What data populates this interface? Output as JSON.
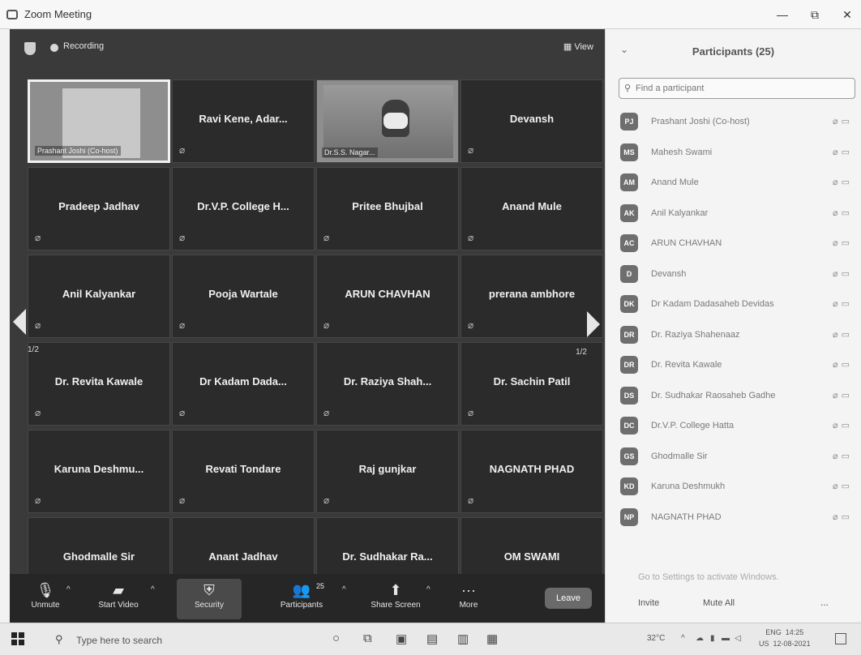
{
  "window": {
    "title": "Zoom Meeting",
    "controls": [
      "—",
      "⧉",
      "✕"
    ]
  },
  "meeting": {
    "recording_label": "Recording",
    "view_label": "View",
    "page_left": "1/2",
    "page_right": "1/2"
  },
  "tiles": [
    {
      "name": "Prashant Joshi (Co-host)",
      "type": "self"
    },
    {
      "name": "Ravi Kene, Adar...",
      "type": "name"
    },
    {
      "name": "Dr.S.S. Nagar...",
      "type": "video"
    },
    {
      "name": "Devansh",
      "type": "name"
    },
    {
      "name": "Pradeep Jadhav",
      "type": "name"
    },
    {
      "name": "Dr.V.P. College H...",
      "type": "name"
    },
    {
      "name": "Pritee Bhujbal",
      "type": "name"
    },
    {
      "name": "Anand Mule",
      "type": "name"
    },
    {
      "name": "Anil Kalyankar",
      "type": "name"
    },
    {
      "name": "Pooja Wartale",
      "type": "name"
    },
    {
      "name": "ARUN CHAVHAN",
      "type": "name"
    },
    {
      "name": "prerana ambhore",
      "type": "name"
    },
    {
      "name": "Dr. Revita Kawale",
      "type": "name"
    },
    {
      "name": "Dr Kadam Dada...",
      "type": "name"
    },
    {
      "name": "Dr. Raziya Shah...",
      "type": "name"
    },
    {
      "name": "Dr. Sachin Patil",
      "type": "name"
    },
    {
      "name": "Karuna Deshmu...",
      "type": "name"
    },
    {
      "name": "Revati Tondare",
      "type": "name"
    },
    {
      "name": "Raj gunjkar",
      "type": "name"
    },
    {
      "name": "NAGNATH PHAD",
      "type": "name"
    },
    {
      "name": "Ghodmalle Sir",
      "type": "name"
    },
    {
      "name": "Anant Jadhav",
      "type": "name"
    },
    {
      "name": "Dr. Sudhakar Ra...",
      "type": "name"
    },
    {
      "name": "OM SWAMI",
      "type": "name"
    }
  ],
  "toolbar": {
    "unmute": "Unmute",
    "start_video": "Start Video",
    "security": "Security",
    "participants": "Participants",
    "participants_count": "25",
    "share_screen": "Share Screen",
    "more": "More",
    "leave": "Leave"
  },
  "panel": {
    "title": "Participants (25)",
    "search_placeholder": "Find a participant",
    "participants": [
      {
        "initials": "PJ",
        "name": "Prashant Joshi (Co-host)"
      },
      {
        "initials": "MS",
        "name": "Mahesh Swami"
      },
      {
        "initials": "AM",
        "name": "Anand Mule"
      },
      {
        "initials": "AK",
        "name": "Anil Kalyankar"
      },
      {
        "initials": "AC",
        "name": "ARUN CHAVHAN"
      },
      {
        "initials": "D",
        "name": "Devansh"
      },
      {
        "initials": "DK",
        "name": "Dr Kadam Dadasaheb Devidas"
      },
      {
        "initials": "DR",
        "name": "Dr. Raziya Shahenaaz"
      },
      {
        "initials": "DR",
        "name": "Dr. Revita Kawale"
      },
      {
        "initials": "DS",
        "name": "Dr. Sudhakar Raosaheb Gadhe"
      },
      {
        "initials": "DC",
        "name": "Dr.V.P. College Hatta"
      },
      {
        "initials": "GS",
        "name": "Ghodmalle Sir"
      },
      {
        "initials": "KD",
        "name": "Karuna Deshmukh"
      },
      {
        "initials": "NP",
        "name": "NAGNATH PHAD"
      }
    ],
    "invite": "Invite",
    "mute_all": "Mute All",
    "more": "...",
    "watermark": "Go to Settings to activate Windows."
  },
  "taskbar": {
    "search_placeholder": "Type here to search",
    "temperature": "32°C",
    "lang_top": "ENG",
    "lang_bottom": "US",
    "time": "14:25",
    "date": "12-08-2021"
  }
}
